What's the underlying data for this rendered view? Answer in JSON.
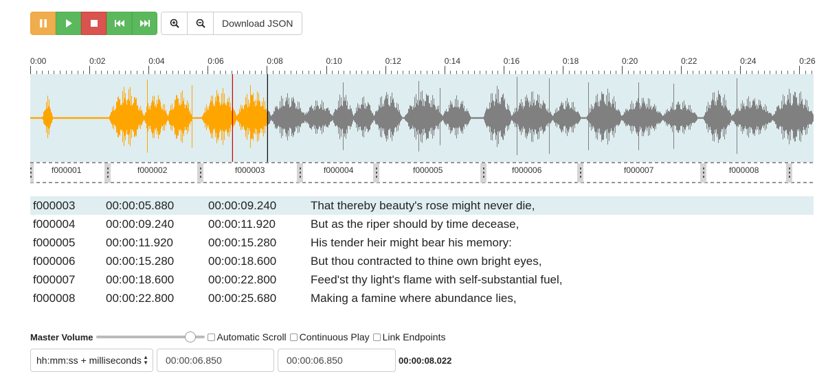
{
  "toolbar": {
    "buttons": [
      "pause",
      "play",
      "stop",
      "skip-backward",
      "skip-forward"
    ],
    "zoom_in_icon": "zoom-in-icon",
    "zoom_out_icon": "zoom-out-icon",
    "download_label": "Download JSON"
  },
  "timeline": {
    "labels": [
      "0:00",
      "0:02",
      "0:04",
      "0:06",
      "0:08",
      "0:10",
      "0:12",
      "0:14",
      "0:16",
      "0:18",
      "0:20",
      "0:22",
      "0:24",
      "0:26"
    ],
    "seconds_per_major_tick": 2,
    "visible_start_seconds": 0,
    "visible_end_seconds": 26.5
  },
  "waveform": {
    "played_color": "#ffa500",
    "unplayed_color": "#808080",
    "background_color": "#deedf0",
    "playhead_seconds": 6.85,
    "current_time_seconds": 8.022,
    "playhead_color": "#cc0000"
  },
  "segments": [
    {
      "id": "f000001"
    },
    {
      "id": "f000002"
    },
    {
      "id": "f000003"
    },
    {
      "id": "f000004"
    },
    {
      "id": "f000005"
    },
    {
      "id": "f000006"
    },
    {
      "id": "f000007"
    },
    {
      "id": "f000008"
    }
  ],
  "fragments": [
    {
      "id": "f000003",
      "begin": "00:00:05.880",
      "end": "00:00:09.240",
      "text": "That thereby beauty's rose might never die,",
      "active": true
    },
    {
      "id": "f000004",
      "begin": "00:00:09.240",
      "end": "00:00:11.920",
      "text": "But as the riper should by time decease,",
      "active": false
    },
    {
      "id": "f000005",
      "begin": "00:00:11.920",
      "end": "00:00:15.280",
      "text": "His tender heir might bear his memory:",
      "active": false
    },
    {
      "id": "f000006",
      "begin": "00:00:15.280",
      "end": "00:00:18.600",
      "text": "But thou contracted to thine own bright eyes,",
      "active": false
    },
    {
      "id": "f000007",
      "begin": "00:00:18.600",
      "end": "00:00:22.800",
      "text": "Feed'st thy light's flame with self-substantial fuel,",
      "active": false
    },
    {
      "id": "f000008",
      "begin": "00:00:22.800",
      "end": "00:00:25.680",
      "text": "Making a famine where abundance lies,",
      "active": false
    }
  ],
  "controls": {
    "master_volume_label": "Master Volume",
    "volume_level": 0.87,
    "auto_scroll_label": "Automatic Scroll",
    "continuous_play_label": "Continuous Play",
    "link_endpoints_label": "Link Endpoints",
    "format_select_value": "hh:mm:ss + milliseconds",
    "begin_field_value": "00:00:06.850",
    "end_field_value": "00:00:06.850",
    "current_time": "00:00:08.022"
  }
}
